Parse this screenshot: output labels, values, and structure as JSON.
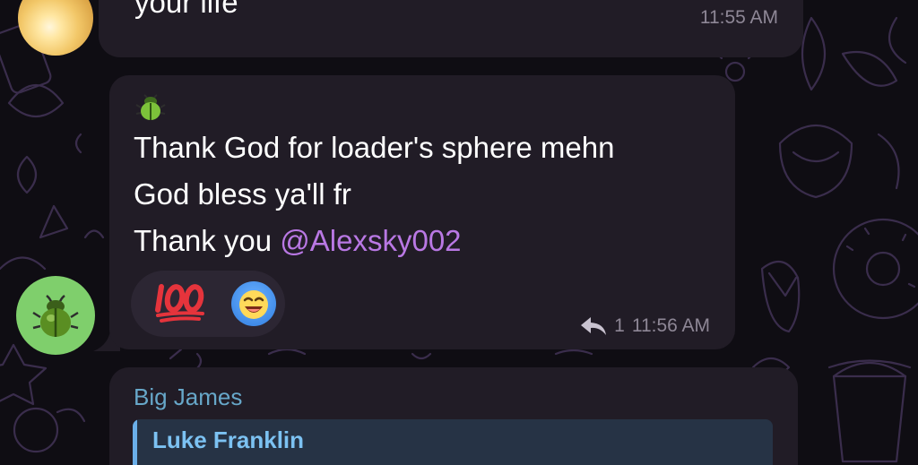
{
  "messages": [
    {
      "id": "m1",
      "text": "your life",
      "time": "11:55 AM"
    },
    {
      "id": "m2",
      "sticker": "beetle-emoji",
      "lines": [
        "Thank God for loader's sphere mehn",
        "God bless ya'll fr"
      ],
      "line3_prefix": "Thank you ",
      "mention": "@Alexsky002",
      "reactions": [
        {
          "icon": "hundred-points-emoji"
        },
        {
          "icon": "laughing-face-emoji"
        }
      ],
      "reply_count": "1",
      "time": "11:56 AM"
    },
    {
      "id": "m3",
      "sender": "Big James",
      "quoted_name": "Luke Franklin"
    }
  ],
  "colors": {
    "bubble": "#211c26",
    "mention": "#b978e4",
    "meta": "#8e8796",
    "sender": "#67a7c9",
    "quote_bg": "#263345",
    "quote_accent": "#6aaee8"
  }
}
